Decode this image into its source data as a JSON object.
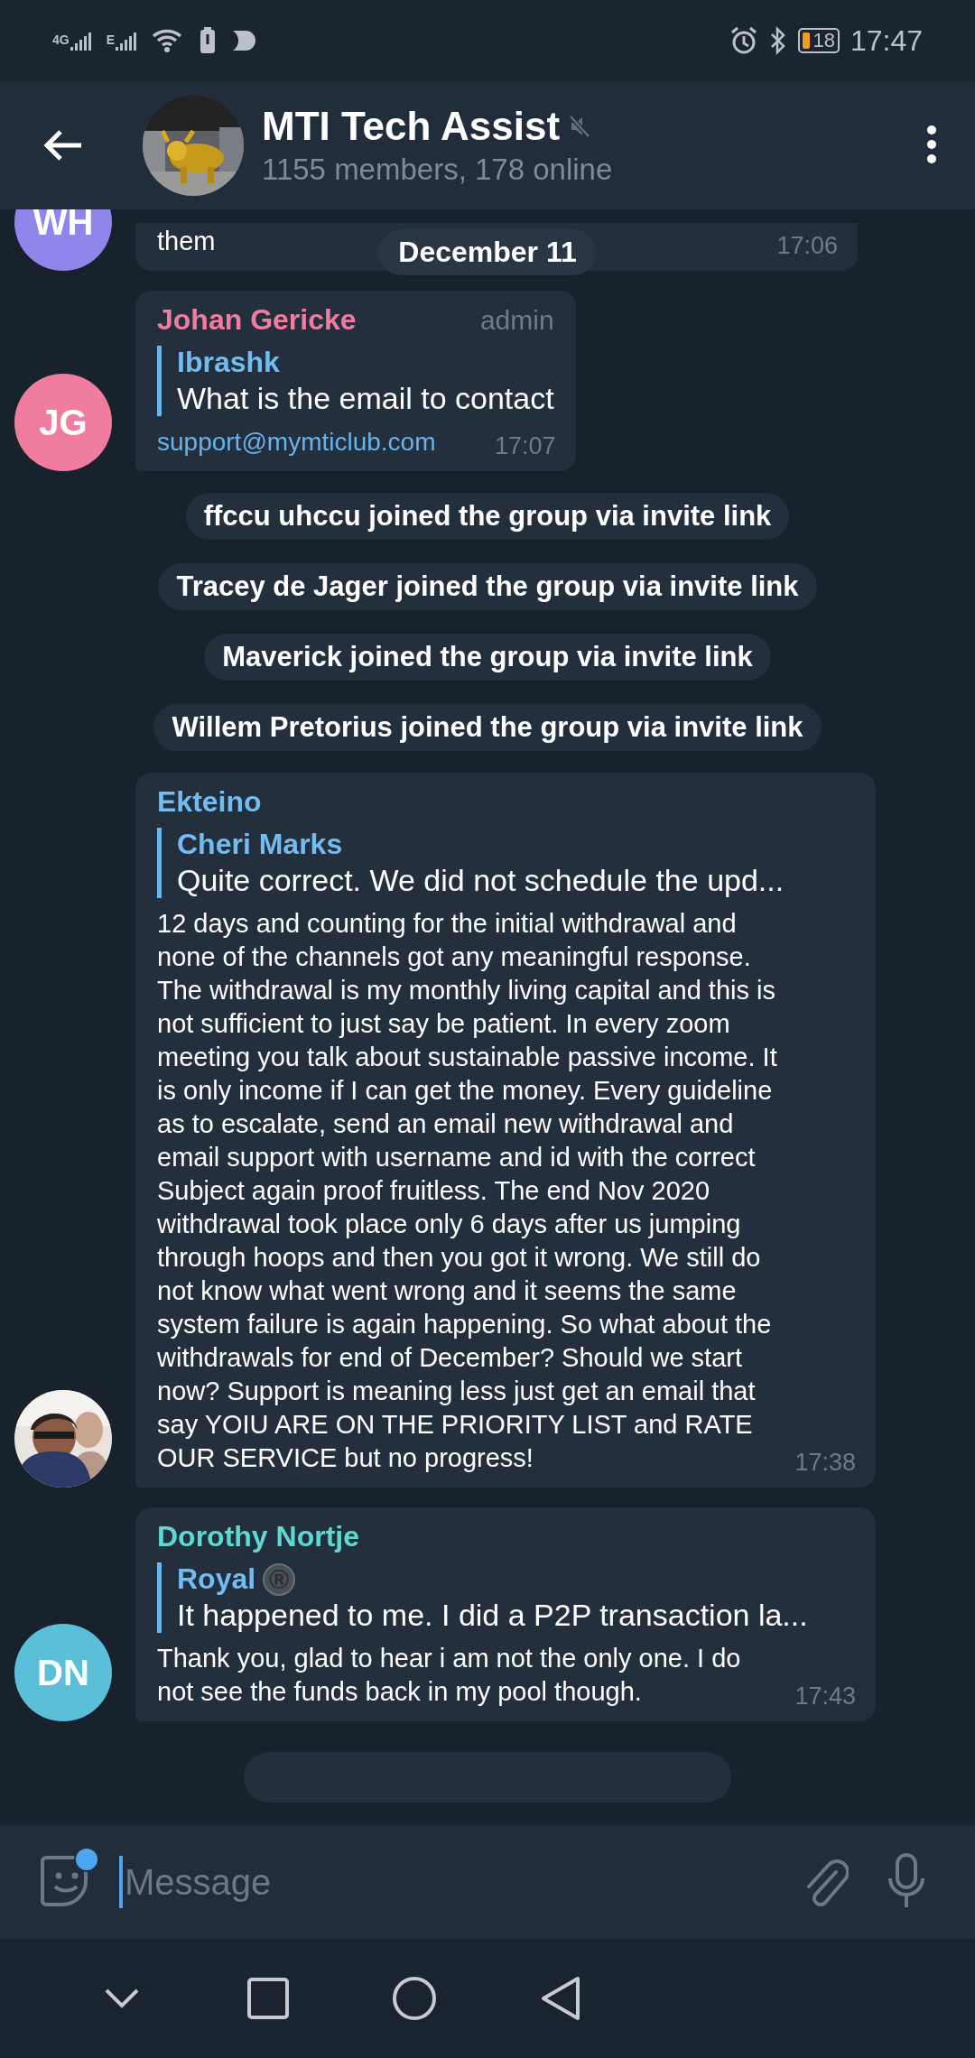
{
  "status_bar": {
    "network_1": "4G",
    "network_2": "E",
    "battery": "18",
    "time": "17:47"
  },
  "header": {
    "title": "MTI Tech Assist",
    "muted": true,
    "subtitle": "1155 members, 178 online"
  },
  "date_badge": "December 11",
  "messages": [
    {
      "kind": "message",
      "avatar": {
        "kind": "initials",
        "initials": "WH",
        "color": "#8f86ec"
      },
      "text": "them",
      "time": "17:06"
    },
    {
      "kind": "message",
      "avatar": {
        "kind": "initials",
        "initials": "JG",
        "color": "#f07ca0"
      },
      "sender": {
        "name": "Johan Gericke",
        "color": "#f07ca0"
      },
      "role": "admin",
      "reply": {
        "name": "Ibrashk",
        "text": "What is the email to contact"
      },
      "text": "support@mymticlub.com",
      "link": true,
      "time": "17:07"
    },
    {
      "kind": "service",
      "text": "ffccu uhccu joined the group via invite link"
    },
    {
      "kind": "service",
      "text": "Tracey de Jager joined the group via invite link"
    },
    {
      "kind": "service",
      "text": "Maverick joined the group via invite link"
    },
    {
      "kind": "service",
      "text": "Willem Pretorius joined the group via invite link"
    },
    {
      "kind": "message",
      "sender": {
        "name": "Ekteino",
        "color": "#72bcf2"
      },
      "reply": {
        "name": "Cheri Marks",
        "text": "Quite correct.  We did not schedule the upd..."
      },
      "text": "12 days and counting for the initial withdrawal and none of the channels got any meaningful response. The withdrawal is my monthly living capital and this is not sufficient to just say be patient. In every zoom meeting you talk about sustainable passive income. It is only  income if I can get the money. Every guideline as to escalate, send an email new withdrawal and email support with username and id with the correct Subject again proof fruitless. The end Nov 2020 withdrawal took place only 6 days after us jumping through hoops and then you got it wrong. We still do not know what went wrong and it seems the same system failure is again happening. So what about the withdrawals for end of December? Should we start now? Support is meaning less just get an email that say YOIU ARE ON THE PRIORITY LIST and RATE OUR SERVICE but no progress!",
      "time": "17:38"
    },
    {
      "kind": "message",
      "avatar": {
        "kind": "initials",
        "initials": "DN",
        "color": "#5bbfd9"
      },
      "sender": {
        "name": "Dorothy Nortje",
        "color": "#5fd8d2"
      },
      "reply": {
        "name": "Royal",
        "badge": "®",
        "text": "It happened to me. I did a P2P transaction la..."
      },
      "text": "Thank you, glad to hear i am not the only one. I do not see the funds back in my pool though.",
      "time": "17:43"
    },
    {
      "kind": "service_cut"
    }
  ],
  "composer": {
    "placeholder": "Message",
    "sticker_dot": true
  }
}
